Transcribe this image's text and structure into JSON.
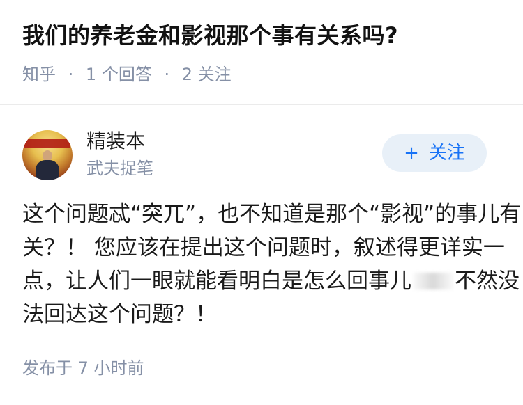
{
  "question": {
    "title": "我们的养老金和影视那个事有关系吗?",
    "meta": {
      "source": "知乎",
      "answer_count": "1 个回答",
      "follower_count": "2 关注"
    }
  },
  "answer": {
    "author": {
      "name": "精装本",
      "headline": "武夫捉笔"
    },
    "follow_button": {
      "label": "关注",
      "icon": "plus-icon"
    },
    "lines": [
      "这个问题忒“突兀”，也不知道是那个“影视”的事儿有",
      "关？！ 您应该在提出这个问题时，叙述得更详实一",
      "点，让人们一眼就能看明白是怎么回事儿",
      "不然没",
      "法回达这个问题？！"
    ],
    "published": "发布于 7 小时前"
  },
  "colors": {
    "muted_text": "#8590a6",
    "follow_text": "#1772f6",
    "follow_bg": "#e8f0f8"
  }
}
